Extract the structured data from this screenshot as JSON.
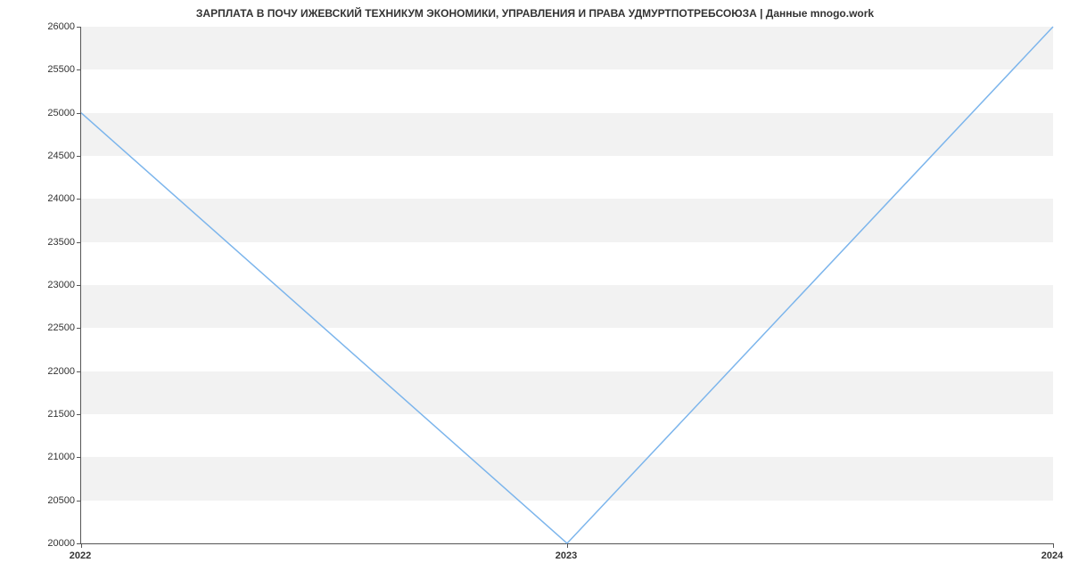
{
  "chart_data": {
    "type": "line",
    "title": "ЗАРПЛАТА В ПОЧУ ИЖЕВСКИЙ ТЕХНИКУМ ЭКОНОМИКИ, УПРАВЛЕНИЯ И ПРАВА УДМУРТПОТРЕБСОЮЗА | Данные mnogo.work",
    "xlabel": "",
    "ylabel": "",
    "x_ticks": [
      "2022",
      "2023",
      "2024"
    ],
    "y_ticks": [
      20000,
      20500,
      21000,
      21500,
      22000,
      22500,
      23000,
      23500,
      24000,
      24500,
      25000,
      25500,
      26000
    ],
    "ylim": [
      20000,
      26000
    ],
    "categories": [
      "2022",
      "2023",
      "2024"
    ],
    "values": [
      25000,
      20000,
      26000
    ],
    "line_color": "#7cb5ec",
    "band_color": "#f2f2f2"
  }
}
